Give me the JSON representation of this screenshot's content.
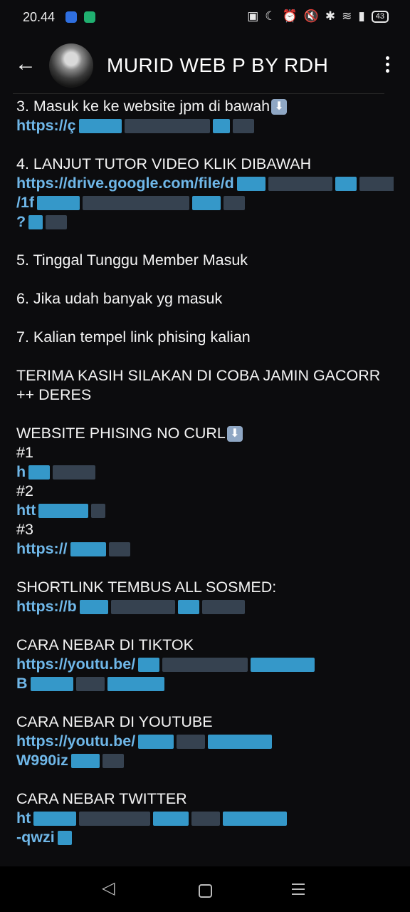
{
  "status": {
    "time": "20.44",
    "battery": "43"
  },
  "header": {
    "title": "MURID WEB P BY RDH",
    "back_icon": "back-arrow-icon",
    "more_icon": "more-vert-icon"
  },
  "messages": [
    {
      "type": "text",
      "text": "3. Masuk ke ke website jpm di bawah",
      "emoji": "⬇"
    },
    {
      "type": "link",
      "text": "https://ç"
    },
    {
      "type": "gap"
    },
    {
      "type": "text",
      "text": "4. LANJUT TUTOR VIDEO KLIK DIBAWAH"
    },
    {
      "type": "link",
      "text": "https://drive.google.com/file/d"
    },
    {
      "type": "link",
      "text": "/1f"
    },
    {
      "type": "link",
      "text": "?"
    },
    {
      "type": "gap"
    },
    {
      "type": "text",
      "text": "5. Tinggal Tunggu Member Masuk"
    },
    {
      "type": "gap"
    },
    {
      "type": "text",
      "text": "6. Jika udah banyak yg masuk"
    },
    {
      "type": "gap"
    },
    {
      "type": "text",
      "text": "7. Kalian tempel link phising kalian"
    },
    {
      "type": "gap"
    },
    {
      "type": "text",
      "text": "TERIMA KASIH SILAKAN DI COBA JAMIN GACORR ++ DERES",
      "wrap": true
    },
    {
      "type": "gap"
    },
    {
      "type": "text",
      "text": "WEBSITE PHISING NO CURL",
      "emoji": "⬇"
    },
    {
      "type": "text",
      "text": "#1"
    },
    {
      "type": "link",
      "text": "h"
    },
    {
      "type": "text",
      "text": "#2"
    },
    {
      "type": "link",
      "text": "htt"
    },
    {
      "type": "text",
      "text": "#3"
    },
    {
      "type": "link",
      "text": "https://"
    },
    {
      "type": "gap"
    },
    {
      "type": "text",
      "text": "SHORTLINK TEMBUS ALL SOSMED:"
    },
    {
      "type": "link",
      "text": "https://b"
    },
    {
      "type": "gap"
    },
    {
      "type": "text",
      "text": "CARA NEBAR DI TIKTOK"
    },
    {
      "type": "link",
      "text": "https://youtu.be/"
    },
    {
      "type": "link",
      "text": "B"
    },
    {
      "type": "gap"
    },
    {
      "type": "text",
      "text": "CARA NEBAR DI YOUTUBE"
    },
    {
      "type": "link",
      "text": "https://youtu.be/"
    },
    {
      "type": "link",
      "text": "W990iz"
    },
    {
      "type": "gap"
    },
    {
      "type": "text",
      "text": "CARA NEBAR TWITTER"
    },
    {
      "type": "link",
      "text": "ht"
    },
    {
      "type": "link",
      "text": "-qwzi"
    }
  ],
  "navbar": {
    "back_icon": "nav-back-icon",
    "home_icon": "nav-home-icon",
    "recents_icon": "nav-recents-icon"
  }
}
